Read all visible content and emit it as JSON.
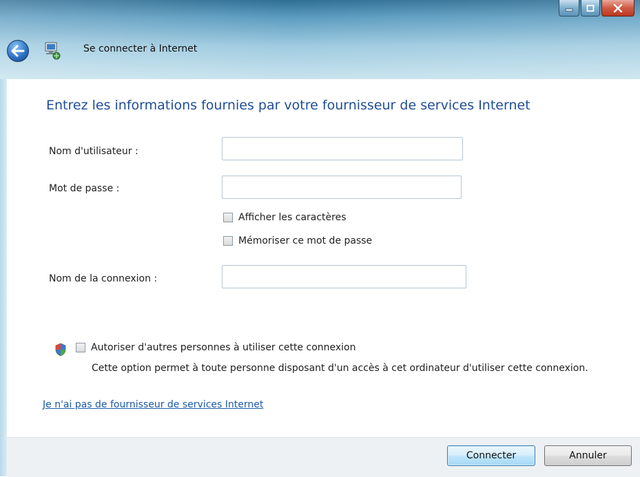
{
  "window": {
    "title": "Se connecter à Internet",
    "controls": {
      "minimize_icon": "minimize-icon",
      "maximize_icon": "maximize-icon",
      "close_icon": "close-icon"
    }
  },
  "icons": {
    "back": "back-arrow-icon",
    "network": "network-connection-icon",
    "uac_shield": "uac-shield-icon"
  },
  "form": {
    "heading": "Entrez les informations fournies par votre fournisseur de services Internet",
    "username": {
      "label": "Nom d'utilisateur :",
      "value": "",
      "placeholder": ""
    },
    "password": {
      "label": "Mot de passe :",
      "value": "",
      "placeholder": ""
    },
    "show_chars": {
      "label": "Afficher les caractères",
      "checked": false
    },
    "remember": {
      "label": "Mémoriser ce mot de passe",
      "checked": false
    },
    "connection_name": {
      "label": "Nom de la connexion :",
      "value": "",
      "placeholder": ""
    },
    "allow_others": {
      "label": "Autoriser d'autres personnes à utiliser cette connexion",
      "checked": false,
      "description": "Cette option permet à toute personne disposant d'un accès à cet ordinateur d'utiliser cette connexion."
    },
    "no_isp_link": "Je n'ai pas de fournisseur de services Internet"
  },
  "buttons": {
    "connect": "Connecter",
    "cancel": "Annuler"
  },
  "colors": {
    "heading": "#1f4e96",
    "link": "#1b5aa8",
    "titlebar_top": "#2f6f95",
    "close_button": "#cf5a43"
  }
}
